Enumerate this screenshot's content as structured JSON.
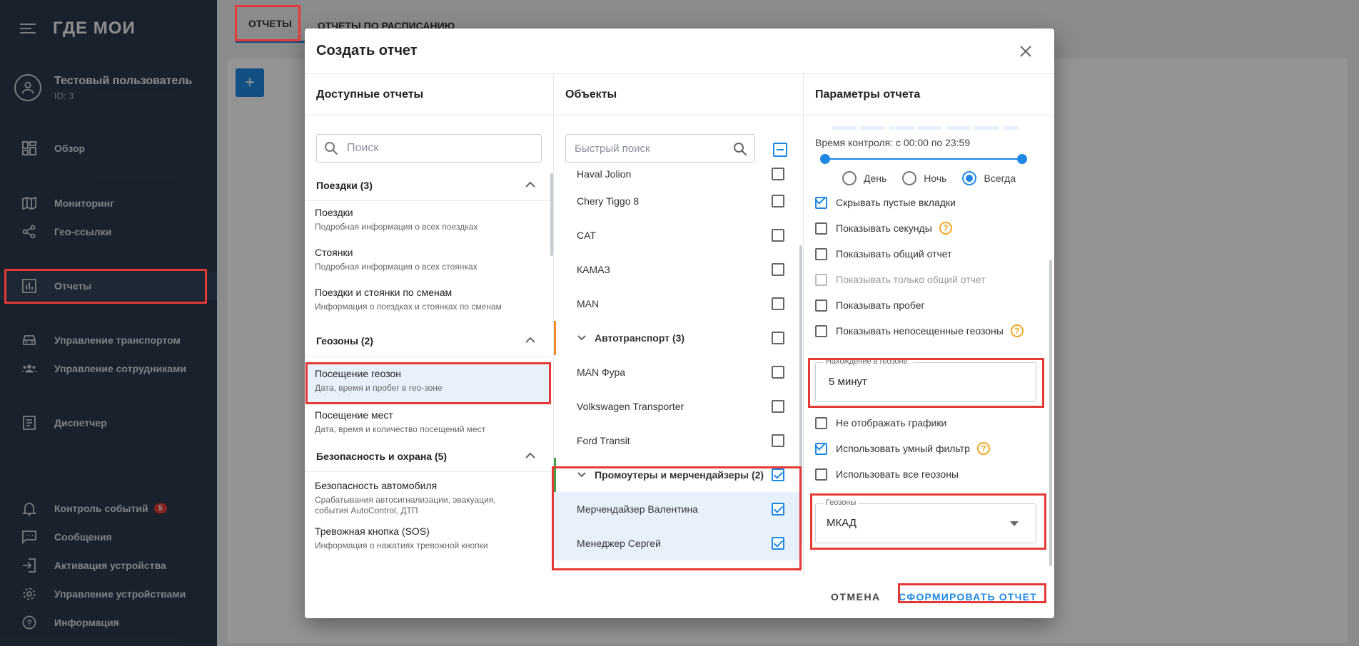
{
  "sidebar": {
    "logo": "ГДЕ МОИ",
    "user_name": "Тестовый пользователь",
    "user_id": "ID: 3",
    "nav": [
      {
        "label": "Обзор",
        "icon": "dashboard-icon"
      },
      {
        "label": "Мониторинг",
        "icon": "map-icon"
      },
      {
        "label": "Гео-ссылки",
        "icon": "share-icon"
      },
      {
        "label": "Отчеты",
        "icon": "reports-icon"
      },
      {
        "label": "Управление транспортом",
        "icon": "car-icon"
      },
      {
        "label": "Управление сотрудниками",
        "icon": "people-icon"
      },
      {
        "label": "Диспетчер",
        "icon": "dispatcher-icon"
      },
      {
        "label": "Контроль событий",
        "icon": "bell-icon",
        "badge": "5"
      },
      {
        "label": "Сообщения",
        "icon": "message-icon"
      },
      {
        "label": "Активация устройства",
        "icon": "login-icon"
      },
      {
        "label": "Управление устройствами",
        "icon": "gear-icon"
      },
      {
        "label": "Информация",
        "icon": "help-icon"
      }
    ]
  },
  "background": {
    "tabs": [
      "ОТЧЕТЫ",
      "ОТЧЕТЫ ПО РАСПИСАНИЮ"
    ]
  },
  "modal": {
    "title": "Создать отчет",
    "col1": {
      "header": "Доступные отчеты",
      "search_placeholder": "Поиск",
      "groups": [
        {
          "title": "Поездки (3)"
        },
        {
          "title": "Геозоны (2)"
        },
        {
          "title": "Безопасность и охрана (5)"
        }
      ],
      "items": [
        {
          "title": "Поездки",
          "desc": "Подробная информация о всех поездках"
        },
        {
          "title": "Стоянки",
          "desc": "Подробная информация о всех стоянках"
        },
        {
          "title": "Поездки и стоянки по сменам",
          "desc": "Информация о поездках и стоянках по сменам"
        },
        {
          "title": "Посещение геозон",
          "desc": "Дата, время и пробег в гео-зоне"
        },
        {
          "title": "Посещение мест",
          "desc": "Дата, время и количество посещений мест"
        },
        {
          "title": "Безопасность автомобиля",
          "desc": "Срабатывания автосигнализации, эвакуация, события AutoControl, ДТП"
        },
        {
          "title": "Тревожная кнопка (SOS)",
          "desc": "Информация о нажатиях тревожной кнопки"
        }
      ]
    },
    "col2": {
      "header": "Объекты",
      "search_placeholder": "Быстрый поиск",
      "objects": [
        {
          "name": "Haval Jolion",
          "checked": false
        },
        {
          "name": "Chery Tiggo 8",
          "checked": false
        },
        {
          "name": "CAT",
          "checked": false
        },
        {
          "name": "КАМАЗ",
          "checked": false
        },
        {
          "name": "MAN",
          "checked": false
        },
        {
          "name": "Автотранспорт (3)",
          "checked": false,
          "group": true
        },
        {
          "name": "MAN Фура",
          "checked": false
        },
        {
          "name": "Volkswagen Transporter",
          "checked": false
        },
        {
          "name": "Ford Transit",
          "checked": false
        },
        {
          "name": "Промоутеры и мерчендайзеры (2)",
          "checked": true,
          "group": true
        },
        {
          "name": "Мерчендайзер Валентина",
          "checked": true
        },
        {
          "name": "Менеджер Сергей",
          "checked": true
        }
      ]
    },
    "col3": {
      "header": "Параметры отчета",
      "control_time": "Время контроля: с 00:00 по 23:59",
      "radios": [
        {
          "label": "День",
          "selected": false
        },
        {
          "label": "Ночь",
          "selected": false
        },
        {
          "label": "Всегда",
          "selected": true
        }
      ],
      "options": [
        {
          "label": "Скрывать пустые вкладки",
          "checked": true
        },
        {
          "label": "Показывать секунды",
          "checked": false,
          "help": true
        },
        {
          "label": "Показывать общий отчет",
          "checked": false
        },
        {
          "label": "Показывать только общий отчет",
          "checked": false,
          "disabled": true
        },
        {
          "label": "Показывать пробег",
          "checked": false
        },
        {
          "label": "Показывать непосещенные геозоны",
          "checked": false,
          "help": true
        }
      ],
      "geozone_time_label": "Нахождение в геозоне:",
      "geozone_time_value": "5 минут",
      "options2": [
        {
          "label": "Не отображать графики",
          "checked": false
        },
        {
          "label": "Использовать умный фильтр",
          "checked": true,
          "help": true
        },
        {
          "label": "Использовать все геозоны",
          "checked": false
        }
      ],
      "geozones_label": "Геозоны",
      "geozones_value": "МКАД"
    },
    "cancel_label": "ОТМЕНА",
    "submit_label": "СФОРМИРОВАТЬ ОТЧЕТ"
  },
  "colors": {
    "sidebar_bg": "#2b3a4d",
    "accent": "#1e88e5",
    "annotation": "#e53935",
    "help": "#f5a623"
  }
}
